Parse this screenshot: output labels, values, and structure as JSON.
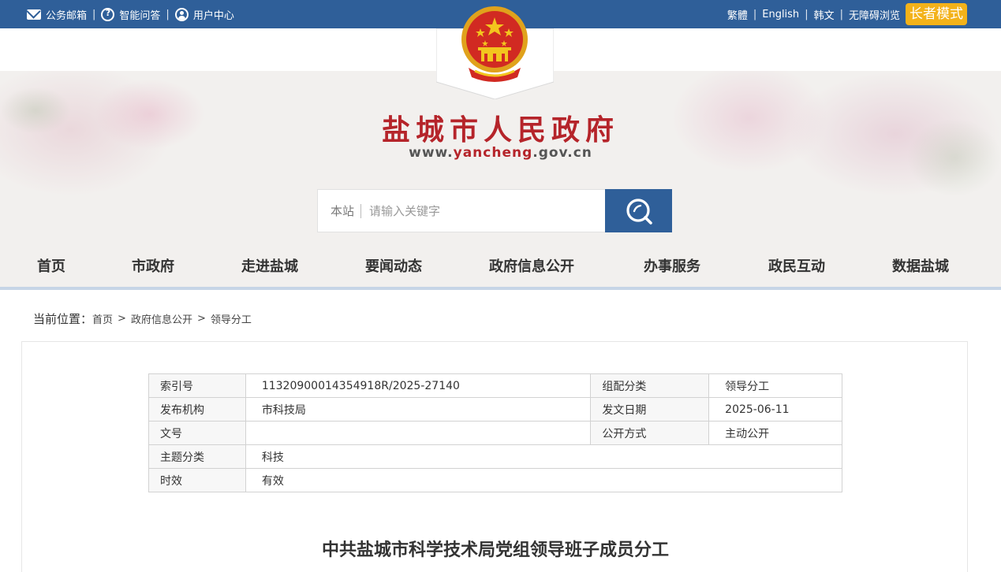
{
  "topbar": {
    "left": [
      {
        "label": "公务邮箱",
        "icon": "mail-icon"
      },
      {
        "label": "智能问答",
        "icon": "chat-question-icon"
      },
      {
        "label": "用户中心",
        "icon": "user-icon"
      }
    ],
    "right": {
      "traditional": "繁體",
      "english": "English",
      "korean": "韩文",
      "accessible": "无障碍浏览",
      "elder_mode": "长者模式"
    }
  },
  "header": {
    "title": "盐城市人民政府",
    "url_prefix": "www.",
    "url_highlight": "yancheng",
    "url_suffix": ".gov.cn",
    "emblem_icon": "national-emblem-icon"
  },
  "search": {
    "scope": "本站",
    "placeholder": "请输入关键字",
    "button_icon": "search-icon"
  },
  "nav": {
    "items": [
      {
        "label": "首页"
      },
      {
        "label": "市政府"
      },
      {
        "label": "走进盐城"
      },
      {
        "label": "要闻动态"
      },
      {
        "label": "政府信息公开"
      },
      {
        "label": "办事服务"
      },
      {
        "label": "政民互动"
      },
      {
        "label": "数据盐城"
      }
    ],
    "active_index": 6
  },
  "breadcrumb": {
    "label": "当前位置：",
    "items": [
      "首页",
      "政府信息公开",
      "领导分工"
    ],
    "separator": ">"
  },
  "meta": {
    "index_no_label": "索引号",
    "index_no": "11320900014354918R/2025-27140",
    "category_label": "组配分类",
    "category": "领导分工",
    "publisher_label": "发布机构",
    "publisher": "市科技局",
    "date_label": "发文日期",
    "date": "2025-06-11",
    "doc_no_label": "文号",
    "doc_no": "",
    "disclosure_label": "公开方式",
    "disclosure": "主动公开",
    "topic_label": "主题分类",
    "topic": "科技",
    "validity_label": "时效",
    "validity": "有效"
  },
  "document": {
    "title": "中共盐城市科学技术局党组领导班子成员分工"
  },
  "colors": {
    "brand_blue": "#2f5f99",
    "title_red": "#b5242a",
    "elder_gold": "#f3b21a"
  }
}
